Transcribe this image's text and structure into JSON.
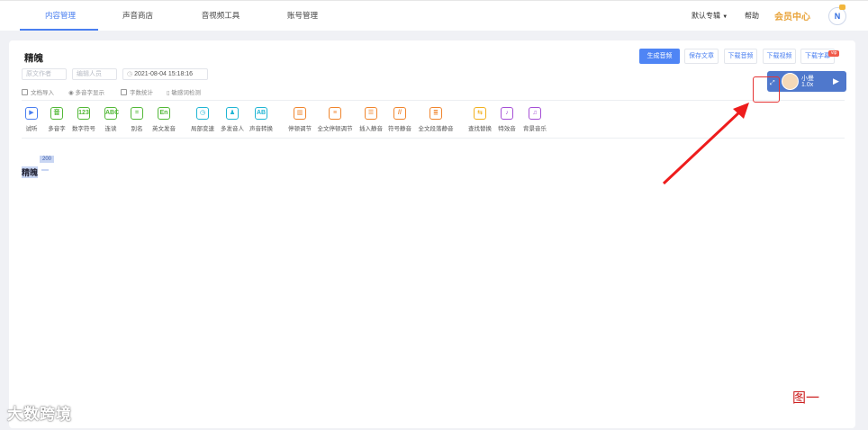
{
  "nav": {
    "tabs": [
      "内容管理",
      "声音商店",
      "音视频工具",
      "账号管理"
    ],
    "album": "默认专辑",
    "help": "帮助",
    "member": "会员中心",
    "avatar_letter": "N"
  },
  "doc": {
    "title": "精魄",
    "author_placeholder": "原文作者",
    "editor_placeholder": "编辑人员",
    "datetime": "2021-08-04 15:18:16",
    "tools": [
      "文档导入",
      "多音字显示",
      "字数统计",
      "敏感词检测"
    ],
    "content_text": "精魄",
    "speed_badge": "200"
  },
  "toolbar": [
    {
      "label": "试听",
      "glyph": "▶",
      "color": "#4a7ff0"
    },
    {
      "label": "多音字",
      "glyph": "音",
      "color": "#52b837"
    },
    {
      "label": "数字符号",
      "glyph": "123",
      "color": "#52b837"
    },
    {
      "label": "连读",
      "glyph": "ABC",
      "color": "#52b837"
    },
    {
      "label": "别名",
      "glyph": "=",
      "color": "#52b837"
    },
    {
      "label": "英文发音",
      "glyph": "En",
      "color": "#52b837"
    },
    {
      "label": "局部变速",
      "glyph": "◷",
      "color": "#1fb5d4"
    },
    {
      "label": "多发音人",
      "glyph": "♟",
      "color": "#1fb5d4"
    },
    {
      "label": "声音转换",
      "glyph": "AB",
      "color": "#1fb5d4"
    },
    {
      "label": "停顿调节",
      "glyph": "▥",
      "color": "#f0852d"
    },
    {
      "label": "全文停顿调节",
      "glyph": "≡",
      "color": "#f0852d"
    },
    {
      "label": "插入静音",
      "glyph": "☰",
      "color": "#f0852d"
    },
    {
      "label": "符号静音",
      "glyph": "//",
      "color": "#f0852d"
    },
    {
      "label": "全文段落静音",
      "glyph": "≣",
      "color": "#f0852d"
    },
    {
      "label": "查找替换",
      "glyph": "⇆",
      "color": "#f2b01e"
    },
    {
      "label": "特效音",
      "glyph": "♪",
      "color": "#a64fd6"
    },
    {
      "label": "背景音乐",
      "glyph": "♫",
      "color": "#a64fd6"
    }
  ],
  "actions": {
    "generate": "生成音频",
    "save": "保存文章",
    "dl_audio": "下载音频",
    "dl_video": "下载视频",
    "dl_subtitle": "下载字幕",
    "vip_badge": "vip"
  },
  "player": {
    "voice": "小曼",
    "speed": "1.0x"
  },
  "annotation": {
    "figure_label": "图一"
  },
  "watermark": "大数跨境"
}
